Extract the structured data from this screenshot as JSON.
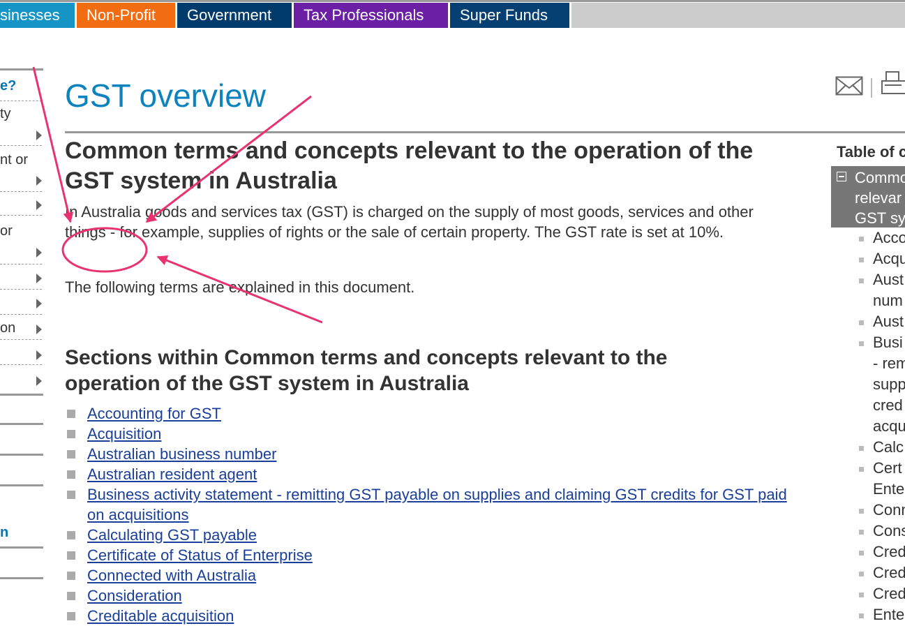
{
  "topnav": {
    "tabs": [
      {
        "label": "sinesses",
        "color": "#1495c5"
      },
      {
        "label": "Non-Profit",
        "color": "#f26d12"
      },
      {
        "label": "Government",
        "color": "#003b6c"
      },
      {
        "label": "Tax Professionals",
        "color": "#6b1fa5"
      },
      {
        "label": "Super Funds",
        "color": "#063f71"
      }
    ]
  },
  "sidebar": {
    "items": [
      "e?",
      "ty",
      "nt or",
      "or",
      "on",
      "n"
    ]
  },
  "main": {
    "page_title": "GST overview",
    "heading": "Common terms and concepts relevant to the operation of the GST system in Australia",
    "intro": "In Australia goods and services tax (GST) is charged on the supply of most goods, services and other things - for example, supplies of rights or the sale of certain property. The GST rate is set at 10%.",
    "following": "The following terms are explained in this document.",
    "sections_heading": "Sections within Common terms and concepts relevant to the operation of the GST system in Australia",
    "sections": [
      "Accounting for GST",
      "Acquisition",
      "Australian business number",
      "Australian resident agent",
      "Business activity statement - remitting GST payable on supplies and claiming GST credits for GST paid on acquisitions",
      "Calculating GST payable",
      "Certificate of Status of Enterprise",
      "Connected with Australia",
      "Consideration",
      "Creditable acquisition"
    ]
  },
  "right": {
    "toc_title": "Table of c",
    "toc_current": [
      "Commo",
      "relevar",
      "GST sy"
    ],
    "toc_items": [
      "Acco",
      "Acqu",
      "Aust",
      "num",
      "Aust",
      "Busi",
      "- rem",
      "supp",
      "cred",
      "acqu",
      "Calc",
      "Cert",
      "Ente",
      "Conn",
      "Cons",
      "Cred",
      "Cred",
      "Cred",
      "Ente"
    ]
  },
  "colors": {
    "accent": "#0c83bf",
    "annotation": "#e8336e",
    "link": "#1a3f9a"
  }
}
